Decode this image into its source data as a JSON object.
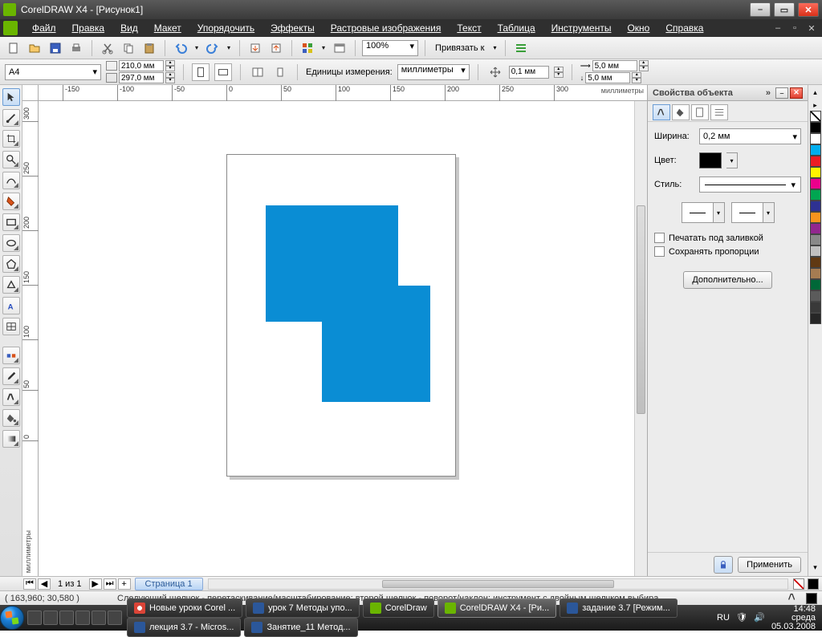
{
  "window": {
    "title": "CorelDRAW X4 - [Рисунок1]"
  },
  "menu": {
    "items": [
      "Файл",
      "Правка",
      "Вид",
      "Макет",
      "Упорядочить",
      "Эффекты",
      "Растровые изображения",
      "Текст",
      "Таблица",
      "Инструменты",
      "Окно",
      "Справка"
    ]
  },
  "toolbar": {
    "zoom": "100%",
    "snap_label": "Привязать к",
    "page_format": "A4",
    "width": "210,0 мм",
    "height": "297,0 мм",
    "units_label": "Единицы измерения:",
    "units": "миллиметры",
    "nudge": "0,1 мм",
    "dup_x": "5,0 мм",
    "dup_y": "5,0 мм"
  },
  "rulers": {
    "units": "миллиметры",
    "h_ticks": [
      "-150",
      "-100",
      "-50",
      "0",
      "50",
      "100",
      "150",
      "200",
      "250",
      "300"
    ],
    "v_ticks": [
      "300",
      "250",
      "200",
      "150",
      "100",
      "50",
      "0"
    ]
  },
  "docker": {
    "title": "Свойства объекта",
    "width_label": "Ширина:",
    "width_value": "0,2 мм",
    "color_label": "Цвет:",
    "style_label": "Стиль:",
    "print_behind": "Печатать под заливкой",
    "keep_prop": "Сохранять пропорции",
    "advanced": "Дополнительно...",
    "apply": "Применить"
  },
  "pagenav": {
    "info": "1 из 1",
    "tab": "Страница 1"
  },
  "status": {
    "coords": "( 163,960; 30,580 )",
    "hint": "Следующий щелчок - перетаскивание/масштабирование; второй щелчок - поворот/наклон; инструмент с двойным щелчком выбира..."
  },
  "taskbar": {
    "tasks": [
      {
        "label": "Новые уроки Corel ...",
        "icon": "chrome"
      },
      {
        "label": "урок 7 Методы упо...",
        "icon": "word"
      },
      {
        "label": "CorelDraw",
        "icon": "corel"
      },
      {
        "label": "CorelDRAW X4 - [Ри...",
        "icon": "corel",
        "active": true
      },
      {
        "label": "задание 3.7 [Режим...",
        "icon": "word"
      },
      {
        "label": "лекция 3.7 - Micros...",
        "icon": "word"
      },
      {
        "label": "Занятие_11 Метод...",
        "icon": "word"
      }
    ],
    "lang": "RU",
    "time": "14:48",
    "day": "среда",
    "date": "05.03.2008"
  },
  "palette": [
    "#000000",
    "#ffffff",
    "#00aeef",
    "#ed1c24",
    "#fff200",
    "#ec008c",
    "#00a651",
    "#2e3192",
    "#f7941d",
    "#92278f",
    "#898989",
    "#c0c0c0",
    "#603913",
    "#a67c52",
    "#006838",
    "#5b5b5b",
    "#393939",
    "#262626"
  ]
}
